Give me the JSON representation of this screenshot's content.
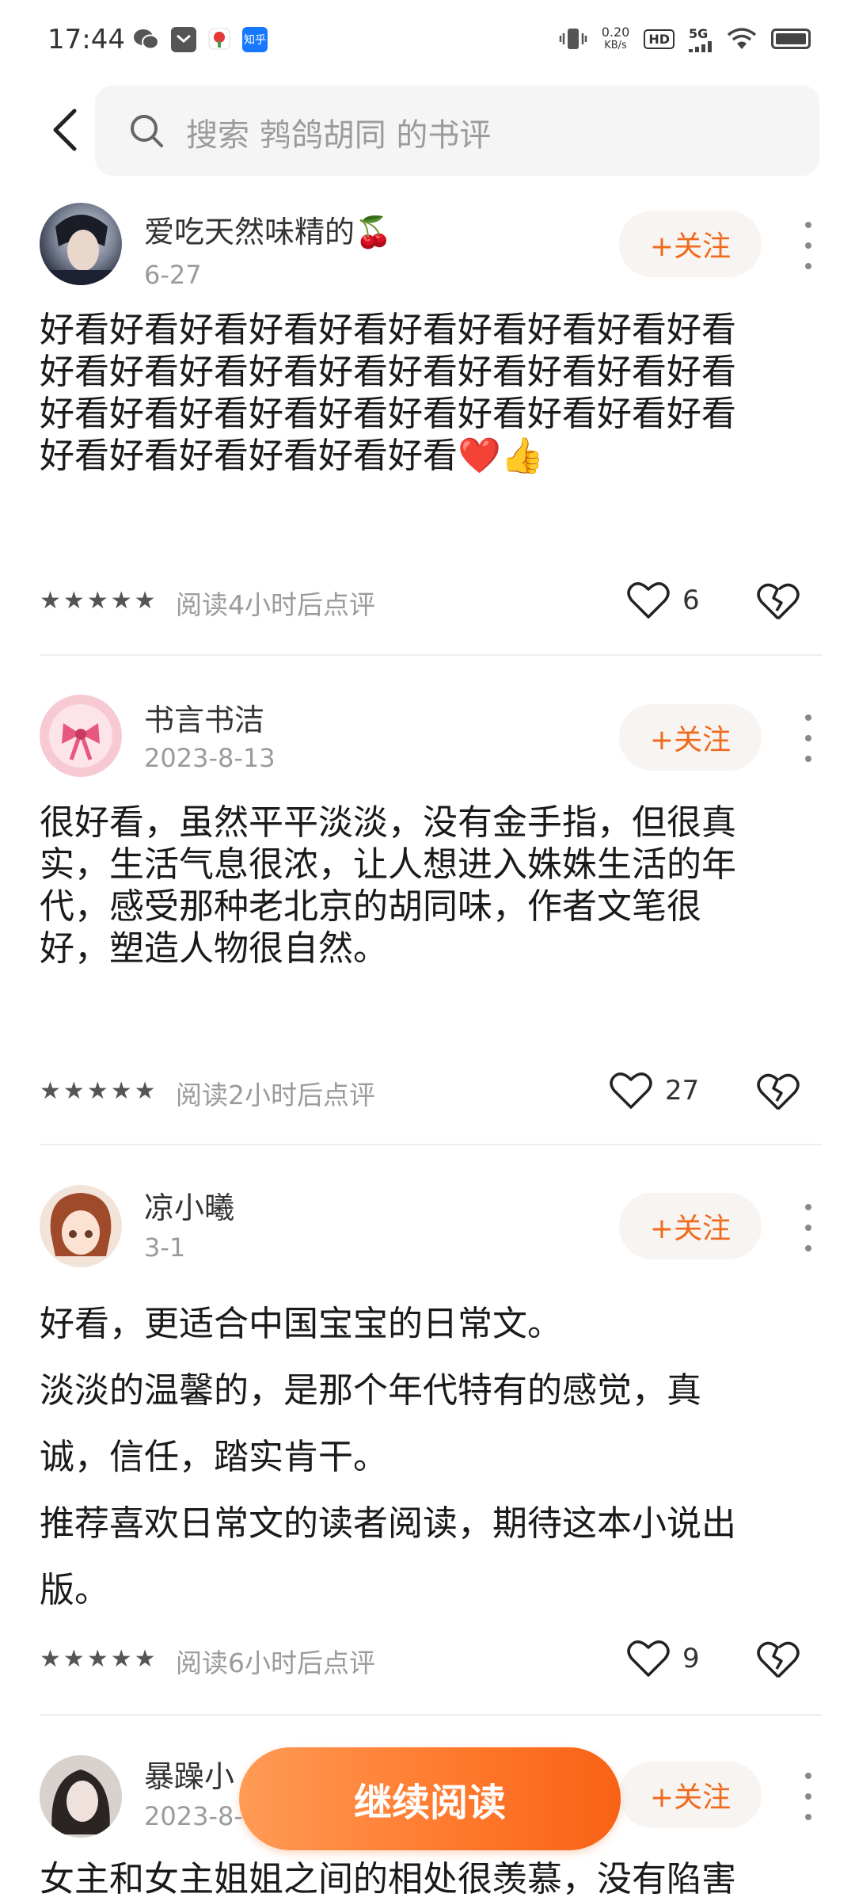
{
  "status_bar": {
    "time": "17:44",
    "net_speed_value": "0.20",
    "net_speed_unit": "KB/s",
    "hd": "HD",
    "network": "5G",
    "zhihu": "知乎"
  },
  "header": {
    "search_placeholder": "搜索 鹁鸽胡同 的书评"
  },
  "reviews": [
    {
      "username": "爱吃天然味精的🍒",
      "date": "6-27",
      "follow_label": "+关注",
      "text": "好看好看好看好看好看好看好看好看好看好看\n好看好看好看好看好看好看好看好看好看好看\n好看好看好看好看好看好看好看好看好看好看\n好看好看好看好看好看好看❤️👍",
      "read_note": "阅读4小时后点评",
      "likes": "6",
      "stars": 5
    },
    {
      "username": "书言书洁",
      "date": "2023-8-13",
      "follow_label": "+关注",
      "text": "很好看，虽然平平淡淡，没有金手指，但很真\n实，生活气息很浓，让人想进入姝姝生活的年\n代，感受那种老北京的胡同味，作者文笔很\n好，塑造人物很自然。",
      "read_note": "阅读2小时后点评",
      "likes": "27",
      "stars": 5
    },
    {
      "username": "凉小曦",
      "date": "3-1",
      "follow_label": "+关注",
      "text": "好看，更适合中国宝宝的日常文。\n淡淡的温馨的，是那个年代特有的感觉，真\n诚，信任，踏实肯干。\n推荐喜欢日常文的读者阅读，期待这本小说出\n版。",
      "read_note": "阅读6小时后点评",
      "likes": "9",
      "stars": 5
    },
    {
      "username": "暴躁小",
      "date": "2023-8-",
      "follow_label": "+关注",
      "text": "女主和女主姐姐之间的相处很羡慕，没有陷害"
    }
  ],
  "continue_label": "继续阅读",
  "colors": {
    "accent": "#f06a1d",
    "follow_bg": "#f7f4f1",
    "muted": "#9b9b9b"
  }
}
